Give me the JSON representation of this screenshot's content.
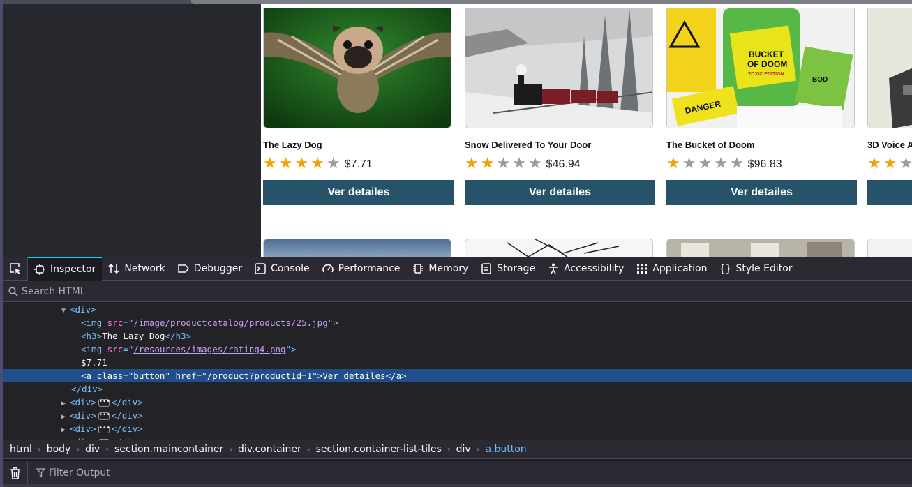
{
  "products": [
    {
      "title": "The Lazy Dog",
      "rating": 4,
      "price": "$7.71",
      "button": "Ver detailes",
      "image": "pug-with-wings"
    },
    {
      "title": "Snow Delivered To Your Door",
      "rating": 2,
      "price": "$46.94",
      "button": "Ver detailes",
      "image": "steam-train-snow"
    },
    {
      "title": "The Bucket of Doom",
      "rating": 1,
      "price": "$96.83",
      "button": "Ver detailes",
      "image": "bucket-of-doom"
    },
    {
      "title": "3D Voice A",
      "rating": 2,
      "price": "",
      "button": "",
      "image": "device"
    }
  ],
  "bucket_art": {
    "bucket_line1": "BUCKET",
    "bucket_line2": "OF DOOM",
    "bucket_line3": "TOXIC EDITION",
    "box_text": "DANGER",
    "badge": "BOD"
  },
  "devtools": {
    "tabs": [
      {
        "label": "Inspector",
        "icon": "inspector-icon",
        "active": true
      },
      {
        "label": "Network",
        "icon": "network-icon"
      },
      {
        "label": "Debugger",
        "icon": "debugger-icon"
      },
      {
        "label": "Console",
        "icon": "console-icon"
      },
      {
        "label": "Performance",
        "icon": "performance-icon"
      },
      {
        "label": "Memory",
        "icon": "memory-icon"
      },
      {
        "label": "Storage",
        "icon": "storage-icon"
      },
      {
        "label": "Accessibility",
        "icon": "accessibility-icon"
      },
      {
        "label": "Application",
        "icon": "application-icon"
      },
      {
        "label": "Style Editor",
        "icon": "style-editor-icon"
      }
    ],
    "search_placeholder": "Search HTML",
    "tree": {
      "div_open": "div",
      "img1_src": "/image/productcatalog/products/25.jpg",
      "h3_text": "The Lazy Dog",
      "img2_src": "/resources/images/rating4.png",
      "price_text": "$7.71",
      "a_class": "button",
      "a_href": "/product?productId=1",
      "a_text": "Ver detailes"
    },
    "breadcrumbs": [
      {
        "tag": "html",
        "cls": ""
      },
      {
        "tag": "body",
        "cls": ""
      },
      {
        "tag": "div",
        "cls": ""
      },
      {
        "tag": "section",
        "cls": ".maincontainer"
      },
      {
        "tag": "div",
        "cls": ".container"
      },
      {
        "tag": "section",
        "cls": ".container-list-tiles"
      },
      {
        "tag": "div",
        "cls": ""
      },
      {
        "tag": "a",
        "cls": ".button",
        "active": true
      }
    ],
    "filter_placeholder": "Filter Output"
  }
}
